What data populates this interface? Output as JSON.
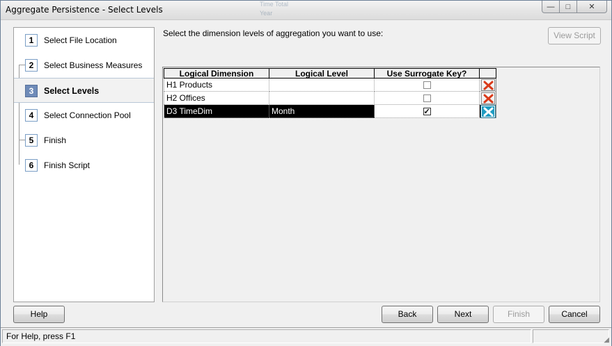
{
  "window": {
    "title": "Aggregate Persistence - Select Levels",
    "background_hint": [
      "Time Total",
      "Year"
    ]
  },
  "caption_buttons": {
    "minimize": "—",
    "maximize": "□",
    "close": "✕"
  },
  "steps": [
    {
      "num": "1",
      "label": "Select File Location",
      "active": false
    },
    {
      "num": "2",
      "label": "Select Business Measures",
      "active": false
    },
    {
      "num": "3",
      "label": "Select Levels",
      "active": true
    },
    {
      "num": "4",
      "label": "Select Connection Pool",
      "active": false
    },
    {
      "num": "5",
      "label": "Finish",
      "active": false
    },
    {
      "num": "6",
      "label": "Finish Script",
      "active": false
    }
  ],
  "main": {
    "instruction": "Select the dimension levels of aggregation you want to use:",
    "view_script_label": "View Script"
  },
  "grid": {
    "headers": [
      "Logical Dimension",
      "Logical Level",
      "Use Surrogate Key?"
    ],
    "rows": [
      {
        "dimension": "H1 Products",
        "level": "",
        "surrogate_key": false,
        "selected": false
      },
      {
        "dimension": "H2 Offices",
        "level": "",
        "surrogate_key": false,
        "selected": false
      },
      {
        "dimension": "D3 TimeDim",
        "level": "Month",
        "surrogate_key": true,
        "selected": true
      }
    ]
  },
  "buttons": {
    "help": "Help",
    "back": "Back",
    "next": "Next",
    "finish": "Finish",
    "cancel": "Cancel"
  },
  "statusbar": {
    "text": "For Help, press F1"
  },
  "colors": {
    "active_step": "#6f8bb8",
    "delete_icon_red": "#d93a1a",
    "delete_icon_selected": "#1e9cc2"
  }
}
